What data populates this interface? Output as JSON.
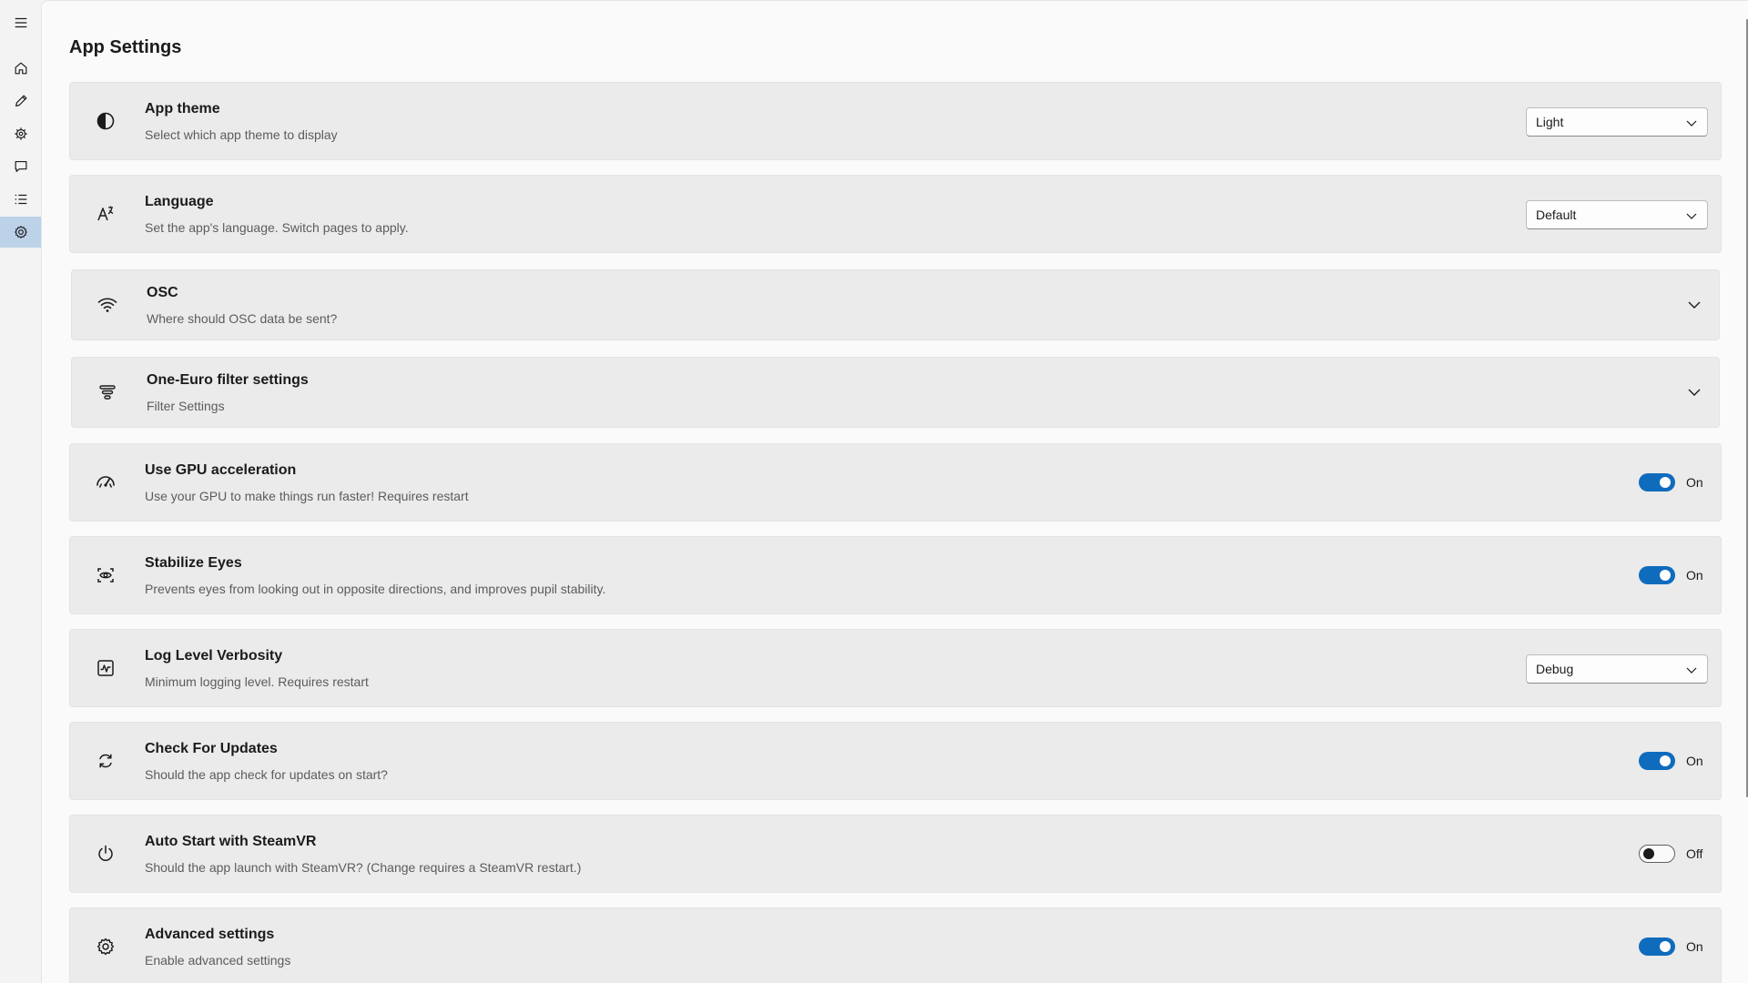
{
  "page": {
    "title": "App Settings"
  },
  "nav": {
    "items": [
      {
        "name": "menu",
        "icon": "hamburger-menu-icon"
      },
      {
        "name": "home",
        "icon": "home-icon"
      },
      {
        "name": "edit",
        "icon": "pencil-icon"
      },
      {
        "name": "algorithm",
        "icon": "gear-cog-icon"
      },
      {
        "name": "chat",
        "icon": "chat-icon"
      },
      {
        "name": "list",
        "icon": "list-icon"
      },
      {
        "name": "settings",
        "icon": "settings-icon",
        "selected": true
      }
    ]
  },
  "settings": [
    {
      "key": "theme",
      "icon": "contrast-icon",
      "title": "App theme",
      "desc": "Select which app theme to display",
      "control": "dropdown",
      "value": "Light"
    },
    {
      "key": "language",
      "icon": "language-icon",
      "title": "Language",
      "desc": "Set the app's language. Switch pages to apply.",
      "control": "dropdown",
      "value": "Default"
    },
    {
      "key": "osc",
      "icon": "wifi-icon",
      "title": "OSC",
      "desc": "Where should OSC data be sent?",
      "control": "expander"
    },
    {
      "key": "filter",
      "icon": "filter-icon",
      "title": "One-Euro filter settings",
      "desc": "Filter Settings",
      "control": "expander"
    },
    {
      "key": "gpu",
      "icon": "gauge-icon",
      "title": "Use GPU acceleration",
      "desc": "Use your GPU to make things run faster! Requires restart",
      "control": "toggle",
      "state": "On"
    },
    {
      "key": "stabilize",
      "icon": "eye-scan-icon",
      "title": "Stabilize Eyes",
      "desc": "Prevents eyes from looking out in opposite directions, and improves pupil stability.",
      "control": "toggle",
      "state": "On"
    },
    {
      "key": "loglevel",
      "icon": "pulse-chart-icon",
      "title": "Log Level Verbosity",
      "desc": "Minimum logging level. Requires restart",
      "control": "dropdown",
      "value": "Debug"
    },
    {
      "key": "updates",
      "icon": "refresh-icon",
      "title": "Check For Updates",
      "desc": "Should the app check for updates on start?",
      "control": "toggle",
      "state": "On"
    },
    {
      "key": "autostart",
      "icon": "power-icon",
      "title": "Auto Start with SteamVR",
      "desc": "Should the app launch with SteamVR? (Change requires a SteamVR restart.)",
      "control": "toggle",
      "state": "Off"
    },
    {
      "key": "advanced",
      "icon": "gear-icon",
      "title": "Advanced settings",
      "desc": "Enable advanced settings",
      "control": "toggle",
      "state": "On"
    }
  ],
  "colors": {
    "accent": "#0f6cbd",
    "nav_selected": "#bcd2e8",
    "card": "#ebebeb"
  }
}
